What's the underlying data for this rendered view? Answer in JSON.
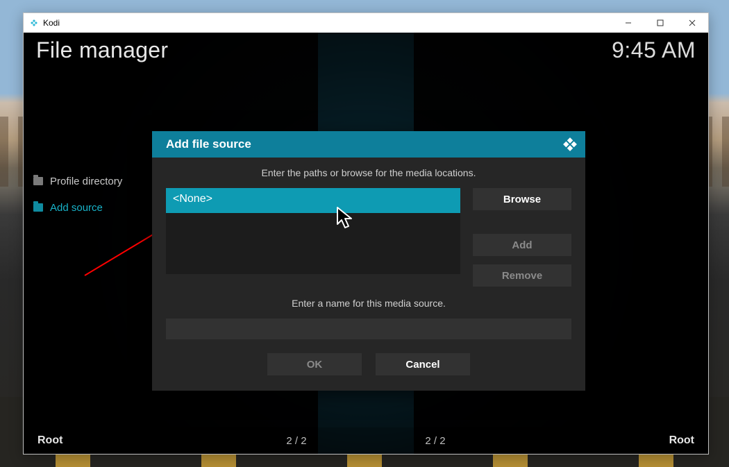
{
  "window": {
    "title": "Kodi"
  },
  "header": {
    "app_title": "File manager",
    "clock": "9:45 AM"
  },
  "file_list": {
    "items": [
      {
        "label": "Profile directory"
      },
      {
        "label": "Add source"
      }
    ]
  },
  "statusbar": {
    "left_label": "Root",
    "left_page": "2 / 2",
    "right_page": "2 / 2",
    "right_label": "Root"
  },
  "dialog": {
    "title": "Add file source",
    "path_hint": "Enter the paths or browse for the media locations.",
    "path_value": "<None>",
    "browse_label": "Browse",
    "add_label": "Add",
    "remove_label": "Remove",
    "name_hint": "Enter a name for this media source.",
    "name_value": "",
    "ok_label": "OK",
    "cancel_label": "Cancel"
  },
  "colors": {
    "accent_header": "#0e7f9b",
    "accent_input": "#0e9bb3",
    "link": "#18b3c9"
  }
}
